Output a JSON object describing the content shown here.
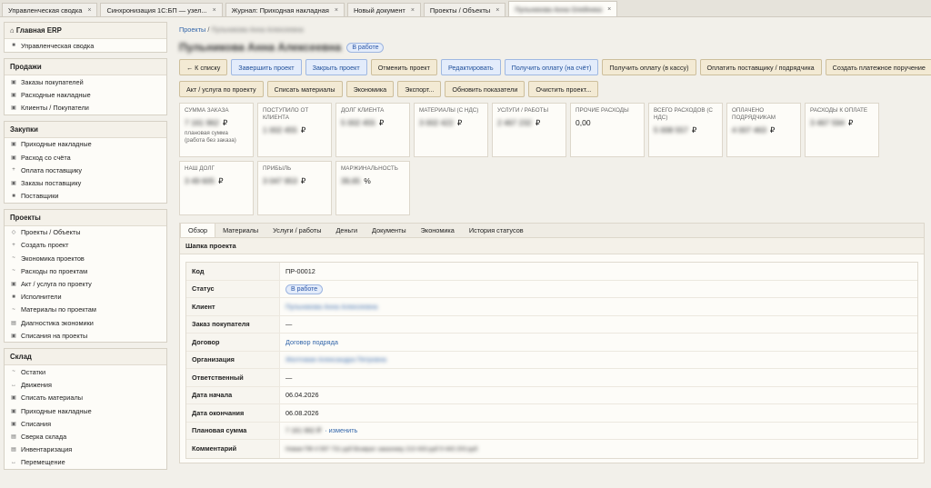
{
  "tabs": [
    {
      "label": "Управленческая сводка",
      "active": false
    },
    {
      "label": "Синхронизация 1С:БП — узел...",
      "active": false
    },
    {
      "label": "Журнал: Приходная накладная",
      "active": false
    },
    {
      "label": "Новый документ",
      "active": false
    },
    {
      "label": "Проекты / Объекты",
      "active": false
    },
    {
      "label": "Пульникова Анна Олейника",
      "active": true
    }
  ],
  "sidebar": {
    "home": {
      "title": "Главная ERP",
      "items": [
        "Управленческая сводка"
      ]
    },
    "sales": {
      "title": "Продажи",
      "items": [
        "Заказы покупателей",
        "Расходные накладные",
        "Клиенты / Покупатели"
      ]
    },
    "purchases": {
      "title": "Закупки",
      "items": [
        "Приходные накладные",
        "Расход со счёта",
        "Оплата поставщику",
        "Заказы поставщику",
        "Поставщики"
      ]
    },
    "projects": {
      "title": "Проекты",
      "items": [
        "Проекты / Объекты",
        "Создать проект",
        "Экономика проектов",
        "Расходы по проектам",
        "Акт / услуга по проекту",
        "Исполнители",
        "Материалы по проектам",
        "Диагностика экономики",
        "Списания на проекты"
      ]
    },
    "warehouse": {
      "title": "Склад",
      "items": [
        "Остатки",
        "Движения",
        "Списать материалы",
        "Приходные накладные",
        "Списания",
        "Сверка склада",
        "Инвентаризация",
        "Перемещение"
      ]
    }
  },
  "breadcrumb": {
    "root": "Проекты",
    "sep": "/",
    "current": "Пульникова Анна Алексеевна"
  },
  "project": {
    "title": "Пульникова Анна Алексеевна",
    "status": "В работе"
  },
  "buttons_row1": [
    "← К списку",
    "Завершить проект",
    "Закрыть проект",
    "Отменить проект",
    "Редактировать",
    "Получить оплату (на счёт)",
    "Получить оплату (в кассу)",
    "Оплатить поставщику / подрядчика",
    "Создать платежное поручение"
  ],
  "buttons_row2": [
    "Акт / услуга по проекту",
    "Списать материалы",
    "Экономика",
    "Экспорт...",
    "Обновить показатели",
    "Очистить проект..."
  ],
  "metrics": [
    {
      "label": "Сумма заказа",
      "value": "7 161 962",
      "currency": "₽",
      "note": "плановая сумма (работа без заказа)"
    },
    {
      "label": "Поступило от клиента",
      "value": "1 002 455",
      "currency": "₽",
      "note": ""
    },
    {
      "label": "Долг клиента",
      "value": "5 002 455",
      "currency": "₽",
      "note": ""
    },
    {
      "label": "Материалы (с НДС)",
      "value": "3 002 422",
      "currency": "₽",
      "note": ""
    },
    {
      "label": "Услуги / работы",
      "value": "2 467 232",
      "currency": "₽",
      "note": ""
    },
    {
      "label": "Прочие расходы",
      "value": "0,00",
      "currency": "",
      "note": ""
    },
    {
      "label": "Всего расходов (с НДС)",
      "value": "5 008 557",
      "currency": "₽",
      "note": ""
    },
    {
      "label": "Оплачено подрядчикам",
      "value": "4 007 463",
      "currency": "₽",
      "note": ""
    },
    {
      "label": "Расходы к оплате",
      "value": "3 467 594",
      "currency": "₽",
      "note": ""
    },
    {
      "label": "Наш долг",
      "value": "3 49 605",
      "currency": "₽",
      "note": ""
    },
    {
      "label": "Прибыль",
      "value": "3 047 953",
      "currency": "₽",
      "note": ""
    },
    {
      "label": "Маржинальность",
      "value": "39,65",
      "currency": "%",
      "note": ""
    }
  ],
  "detail_tabs": [
    "Обзор",
    "Материалы",
    "Услуги / работы",
    "Деньги",
    "Документы",
    "Экономика",
    "История статусов"
  ],
  "panel": {
    "title": "Шапка проекта",
    "fields": [
      {
        "key": "Код",
        "value": "ПР-00012",
        "kind": "text"
      },
      {
        "key": "Статус",
        "value": "В работе",
        "kind": "badge"
      },
      {
        "key": "Клиент",
        "value": "Пульникова Анна Алексеевна",
        "kind": "blurlink"
      },
      {
        "key": "Заказ покупателя",
        "value": "—",
        "kind": "text"
      },
      {
        "key": "Договор",
        "value": "Договор подряда",
        "kind": "link"
      },
      {
        "key": "Организация",
        "value": "Желтовая Александра Петровна",
        "kind": "blurlink"
      },
      {
        "key": "Ответственный",
        "value": "—",
        "kind": "text"
      },
      {
        "key": "Дата начала",
        "value": "06.04.2026",
        "kind": "text"
      },
      {
        "key": "Дата окончания",
        "value": "06.08.2026",
        "kind": "text"
      },
      {
        "key": "Плановая сумма",
        "value": "7 161 962 ₽",
        "extra": "· изменить",
        "kind": "blurtext"
      },
      {
        "key": "Комментарий",
        "value": "Новая ПФ 4 597 731 руб Возврат заказчику 213 433 руб 9 443 203 руб",
        "kind": "blurtext"
      }
    ]
  }
}
